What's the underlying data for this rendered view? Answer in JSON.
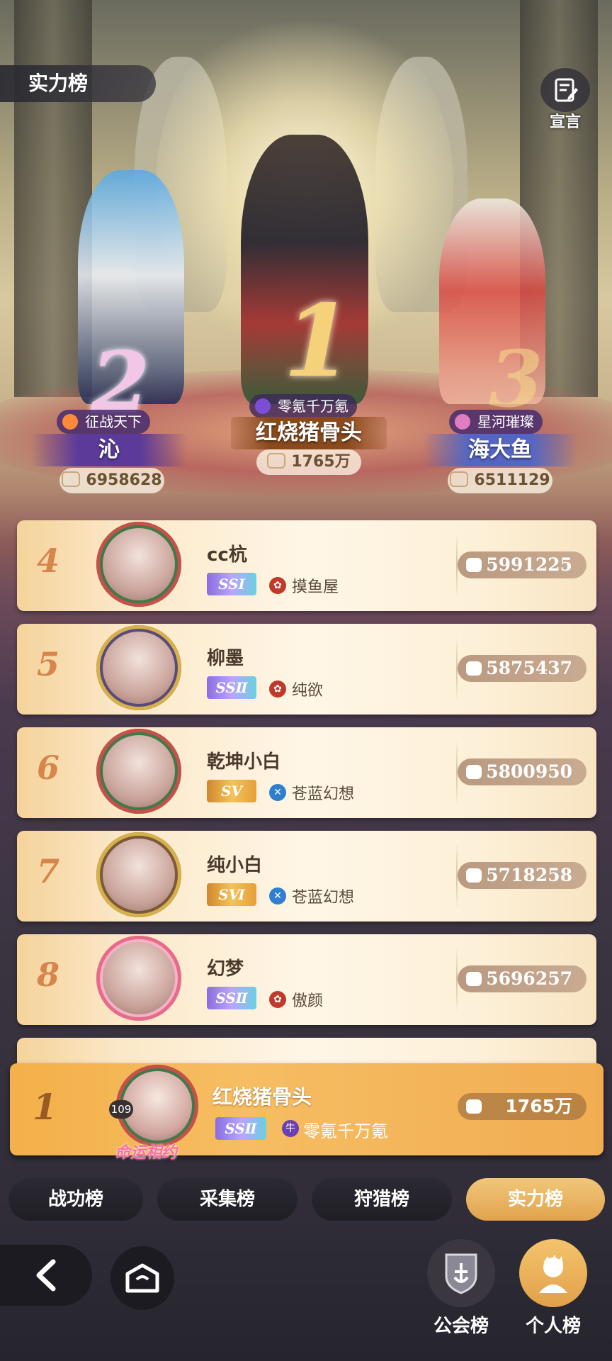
{
  "header": {
    "title": "实力榜",
    "declare_label": "宣言"
  },
  "podium": [
    {
      "rank": "2",
      "guild": "征战天下",
      "name": "沁",
      "score": "6958628",
      "guild_color": "#ff8a3a"
    },
    {
      "rank": "1",
      "guild": "零氪千万氪",
      "name": "红烧猪骨头",
      "score": "1765万",
      "guild_color": "#7c4ed6"
    },
    {
      "rank": "3",
      "guild": "星河璀璨",
      "name": "海大鱼",
      "score": "6511129",
      "guild_color": "#e07cc0"
    }
  ],
  "rows": [
    {
      "rank": "4",
      "name": "cc杭",
      "tier": "SSⅠ",
      "guild": "摸鱼屋",
      "guild_color": "#c0392b",
      "score": "5991225"
    },
    {
      "rank": "5",
      "name": "柳墨",
      "tier": "SSⅡ",
      "guild": "纯欲",
      "guild_color": "#c0392b",
      "score": "5875437"
    },
    {
      "rank": "6",
      "name": "乾坤小白",
      "tier": "SⅤ",
      "guild": "苍蓝幻想",
      "guild_color": "#2f7fd0",
      "score": "5800950"
    },
    {
      "rank": "7",
      "name": "纯小白",
      "tier": "SⅥ",
      "guild": "苍蓝幻想",
      "guild_color": "#2f7fd0",
      "score": "5718258"
    },
    {
      "rank": "8",
      "name": "幻梦",
      "tier": "SSⅡ",
      "guild": "傲颜",
      "guild_color": "#c0392b",
      "score": "5696257"
    }
  ],
  "self": {
    "rank": "1",
    "level": "109",
    "name": "红烧猪骨头",
    "tier": "SSⅡ",
    "guild": "零氪千万氪",
    "score": "1765万",
    "frame_text": "命运相约"
  },
  "tabs": [
    {
      "label": "战功榜",
      "active": false
    },
    {
      "label": "采集榜",
      "active": false
    },
    {
      "label": "狩猎榜",
      "active": false
    },
    {
      "label": "实力榜",
      "active": true
    }
  ],
  "bottom_nav": {
    "guild_label": "公会榜",
    "personal_label": "个人榜"
  },
  "colors": {
    "accent": "#f1b24e",
    "rank_number": "#d7854a",
    "score_pill": "#bf9f86"
  }
}
